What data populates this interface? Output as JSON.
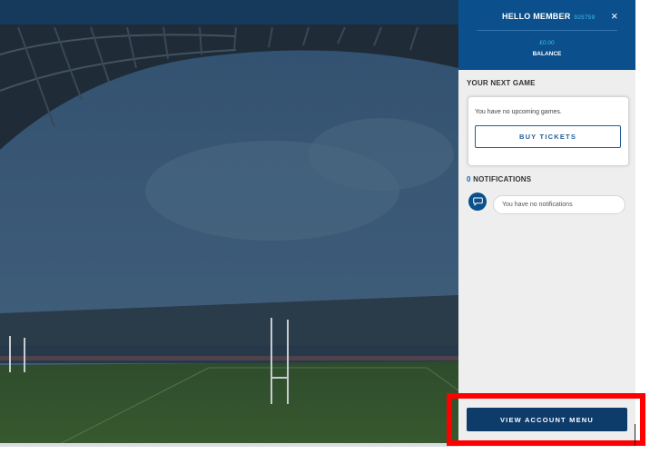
{
  "account_panel": {
    "greeting": "HELLO MEMBER",
    "member_number": "925759",
    "close_symbol": "×",
    "balance_value": "£0.00",
    "balance_label": "BALANCE",
    "next_game": {
      "title": "YOUR NEXT GAME",
      "empty_message": "You have no upcoming games.",
      "buy_tickets_label": "BUY TICKETS"
    },
    "notifications": {
      "count": "0",
      "title": "NOTIFICATIONS",
      "empty_message": "You have no notifications",
      "icon": "chat-bubble-icon"
    },
    "view_account_menu_label": "VIEW ACCOUNT MENU"
  },
  "colors": {
    "header_blue": "#0b4f8c",
    "accent_cyan": "#3fc0ef",
    "button_navy": "#0d3c6b",
    "highlight_red": "#ff0000",
    "panel_gray": "#eeeeee"
  }
}
